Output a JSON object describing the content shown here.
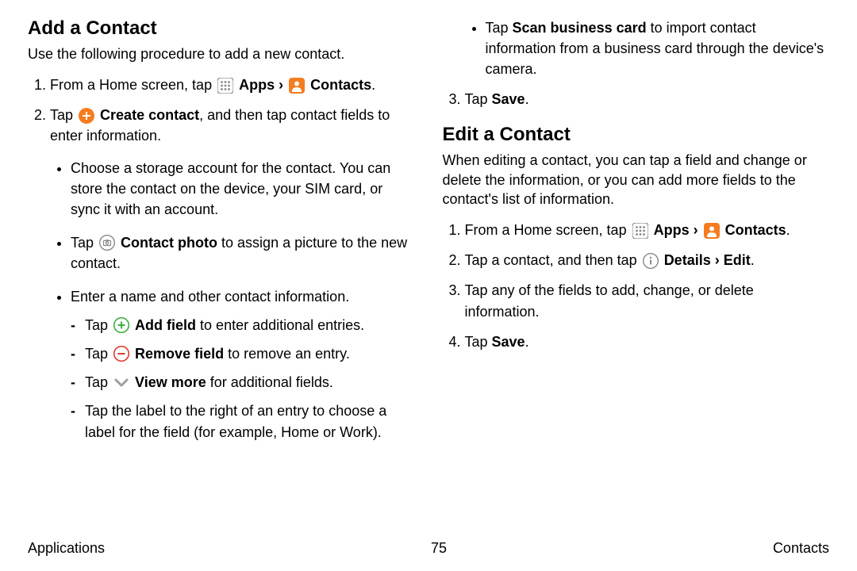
{
  "left": {
    "heading": "Add a Contact",
    "intro": "Use the following procedure to add a new contact.",
    "step1_a": "From a Home screen, tap ",
    "apps": "Apps",
    "chev": " › ",
    "contacts": "Contacts",
    "period": ".",
    "step2_pre": "Tap ",
    "step2_b": "Create contact",
    "step2_post": ", and then tap contact fields to enter information.",
    "b1": "Choose a storage account for the contact. You can store the contact on the device, your SIM card, or sync it with an account.",
    "b2_pre": "Tap ",
    "b2_b": "Contact photo",
    "b2_post": " to assign a picture to the new contact.",
    "b3": "Enter a name and other contact information.",
    "d1_pre": "Tap ",
    "d1_b": "Add field",
    "d1_post": " to enter additional entries.",
    "d2_pre": "Tap ",
    "d2_b": "Remove field",
    "d2_post": " to remove an entry.",
    "d3_pre": "Tap ",
    "d3_b": "View more",
    "d3_post": " for additional fields.",
    "d4": "Tap the label to the right of an entry to choose a label for the field (for example, Home or Work)."
  },
  "right": {
    "b_scan_pre": "Tap ",
    "b_scan_b": "Scan business card",
    "b_scan_post": " to import contact information from a business card through the device's camera.",
    "step3_pre": "Tap ",
    "step3_b": "Save",
    "step3_post": ".",
    "heading": "Edit a Contact",
    "intro": "When editing a contact, you can tap a field and change or delete the information, or you can add more fields to the contact's list of information.",
    "e1_pre": "From a Home screen, tap ",
    "apps": "Apps",
    "chev": " › ",
    "contacts": "Contacts",
    "period": ".",
    "e2_pre": "Tap a contact, and then tap ",
    "e2_b": "Details",
    "e2_mid": " › ",
    "e2_b2": "Edit",
    "e2_post": ".",
    "e3": "Tap any of the fields to add, change, or delete information.",
    "e4_pre": "Tap ",
    "e4_b": "Save",
    "e4_post": "."
  },
  "footer": {
    "left": "Applications",
    "center": "75",
    "right": "Contacts"
  }
}
